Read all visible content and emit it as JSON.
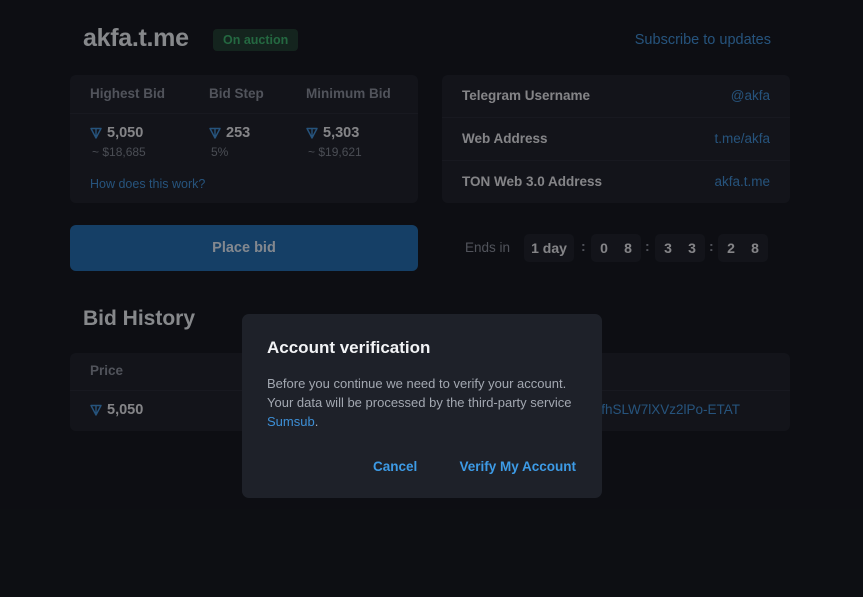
{
  "header": {
    "username": "akfa.t.me",
    "status_badge": "On auction",
    "subscribe_link": "Subscribe to updates"
  },
  "bid_info": {
    "columns": [
      {
        "label": "Highest Bid",
        "value": "5,050",
        "sub": "~ $18,685",
        "ton_icon": true
      },
      {
        "label": "Bid Step",
        "value": "253",
        "sub": "5%",
        "ton_icon": true
      },
      {
        "label": "Minimum Bid",
        "value": "5,303",
        "sub": "~ $19,621",
        "ton_icon": true
      }
    ],
    "how_link": "How does this work?"
  },
  "details": {
    "rows": [
      {
        "label": "Telegram Username",
        "value": "@akfa"
      },
      {
        "label": "Web Address",
        "value": "t.me/akfa"
      },
      {
        "label": "TON Web 3.0 Address",
        "value": "akfa.t.me"
      }
    ]
  },
  "actions": {
    "place_bid": "Place bid"
  },
  "timer": {
    "label": "Ends in",
    "days": "1 day",
    "digits": [
      "0",
      "8",
      "3",
      "3",
      "2",
      "8"
    ],
    "separator": ":"
  },
  "bid_history": {
    "title": "Bid History",
    "columns": [
      "Price"
    ],
    "rows": [
      {
        "price": "5,050",
        "address_fragment": "9fhSLW7lXVz2lPo-ETAT"
      }
    ]
  },
  "modal": {
    "title": "Account verification",
    "body_text": "Before you continue we need to verify your account. Your data will be processed by the third-party service ",
    "body_link": "Sumsub",
    "body_end": ".",
    "cancel_label": "Cancel",
    "verify_label": "Verify My Account"
  },
  "colors": {
    "background": "#0f1217",
    "card": "#1a1d24",
    "accent": "#3d8fd6",
    "button": "#1e6aad",
    "badge_bg": "#1c3a2a",
    "badge_text": "#39b56a"
  },
  "icons": {
    "ton": "ton-diamond-icon"
  }
}
